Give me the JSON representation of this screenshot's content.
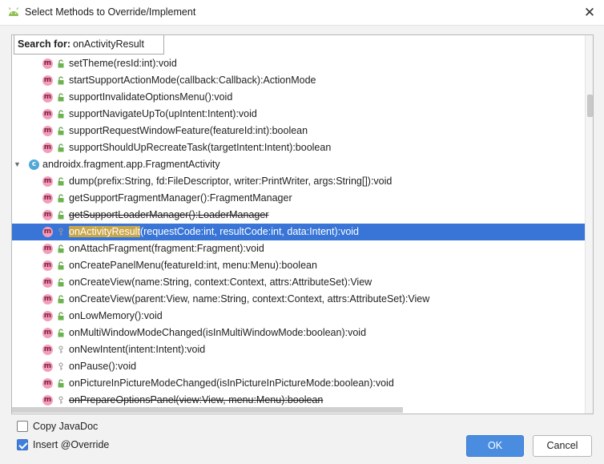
{
  "window": {
    "title": "Select Methods to Override/Implement",
    "close_label": "✕"
  },
  "search": {
    "label": "Search for:",
    "value": "onActivityResult"
  },
  "tree": {
    "rows": [
      {
        "kind": "method",
        "text": "setTheme(resId:int):void",
        "visibility": "public"
      },
      {
        "kind": "method",
        "text": "startSupportActionMode(callback:Callback):ActionMode",
        "visibility": "public"
      },
      {
        "kind": "method",
        "text": "supportInvalidateOptionsMenu():void",
        "visibility": "public"
      },
      {
        "kind": "method",
        "text": "supportNavigateUpTo(upIntent:Intent):void",
        "visibility": "public"
      },
      {
        "kind": "method",
        "text": "supportRequestWindowFeature(featureId:int):boolean",
        "visibility": "public"
      },
      {
        "kind": "method",
        "text": "supportShouldUpRecreateTask(targetIntent:Intent):boolean",
        "visibility": "public"
      },
      {
        "kind": "class",
        "text": "androidx.fragment.app.FragmentActivity"
      },
      {
        "kind": "method",
        "text": "dump(prefix:String, fd:FileDescriptor, writer:PrintWriter, args:String[]):void",
        "visibility": "public"
      },
      {
        "kind": "method",
        "text": "getSupportFragmentManager():FragmentManager",
        "visibility": "public"
      },
      {
        "kind": "method",
        "text": "getSupportLoaderManager():LoaderManager",
        "visibility": "public",
        "deprecated": true
      },
      {
        "kind": "method",
        "match": "onActivityResult",
        "rest": "(requestCode:int, resultCode:int, data:Intent):void",
        "visibility": "protected",
        "selected": true
      },
      {
        "kind": "method",
        "text": "onAttachFragment(fragment:Fragment):void",
        "visibility": "public"
      },
      {
        "kind": "method",
        "text": "onCreatePanelMenu(featureId:int, menu:Menu):boolean",
        "visibility": "public"
      },
      {
        "kind": "method",
        "text": "onCreateView(name:String, context:Context, attrs:AttributeSet):View",
        "visibility": "public"
      },
      {
        "kind": "method",
        "text": "onCreateView(parent:View, name:String, context:Context, attrs:AttributeSet):View",
        "visibility": "public"
      },
      {
        "kind": "method",
        "text": "onLowMemory():void",
        "visibility": "public"
      },
      {
        "kind": "method",
        "text": "onMultiWindowModeChanged(isInMultiWindowMode:boolean):void",
        "visibility": "public"
      },
      {
        "kind": "method",
        "text": "onNewIntent(intent:Intent):void",
        "visibility": "protected"
      },
      {
        "kind": "method",
        "text": "onPause():void",
        "visibility": "protected"
      },
      {
        "kind": "method",
        "text": "onPictureInPictureModeChanged(isInPictureInPictureMode:boolean):void",
        "visibility": "public"
      },
      {
        "kind": "method",
        "text": "onPrepareOptionsPanel(view:View, menu:Menu):boolean",
        "visibility": "protected",
        "deprecated": true
      }
    ]
  },
  "options": {
    "copy_javadoc": {
      "label": "Copy JavaDoc",
      "checked": false
    },
    "insert_override": {
      "label": "Insert @Override",
      "checked": true
    }
  },
  "buttons": {
    "ok": "OK",
    "cancel": "Cancel"
  },
  "colors": {
    "selection": "#3875d7",
    "method_icon": "#f49dbb",
    "class_icon": "#4fa8d8",
    "match_highlight": "#c9a64a",
    "ok_button": "#4a8de0"
  }
}
